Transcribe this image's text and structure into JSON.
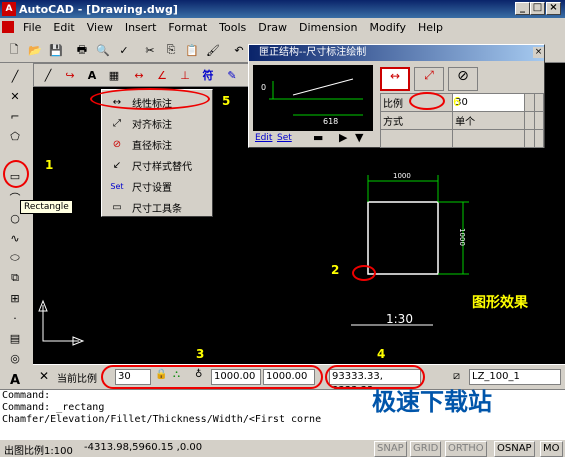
{
  "window": {
    "title": "AutoCAD - [Drawing.dwg]",
    "app_icon_text": "A"
  },
  "menu": [
    "File",
    "Edit",
    "View",
    "Insert",
    "Format",
    "Tools",
    "Draw",
    "Dimension",
    "Modify",
    "Help"
  ],
  "tooltip": "Rectangle",
  "context_menu": {
    "items": [
      "线性标注",
      "对齐标注",
      "直径标注",
      "尺寸样式替代",
      "尺寸设置",
      "尺寸工具条"
    ]
  },
  "dialog": {
    "title": "匣正结构--尺寸标注绘制",
    "preview_value": "618",
    "preview_left": "0",
    "edit_link": "Edit",
    "set_link": "Set",
    "table": {
      "row1_label": "比例",
      "row1_value": "30",
      "row2_label": "方式",
      "row2_value": "单个"
    }
  },
  "drawing": {
    "dim_top": "1000",
    "dim_right": "1000",
    "effect_label": "图形效果",
    "scale_text": "1:30"
  },
  "annotations": [
    "1",
    "2",
    "3",
    "4",
    "5"
  ],
  "status_row": {
    "scale_label": "当前比例",
    "scale_value": "30",
    "coord1": "1000.00",
    "coord2": "1000.00",
    "coord3": "93333.33, 3333.33",
    "layer": "LZ_100_1"
  },
  "command": {
    "lines": [
      "Command:",
      "Command: _rectang",
      "Chamfer/Elevation/Fillet/Thickness/Width/<First corne"
    ]
  },
  "statusbar": {
    "scale": "出图比例1:100",
    "coords": "-4313.98,5960.15 ,0.00",
    "buttons": [
      "SNAP",
      "GRID",
      "ORTHO",
      "OSNAP",
      "MO"
    ]
  },
  "watermark": "极速下载站"
}
